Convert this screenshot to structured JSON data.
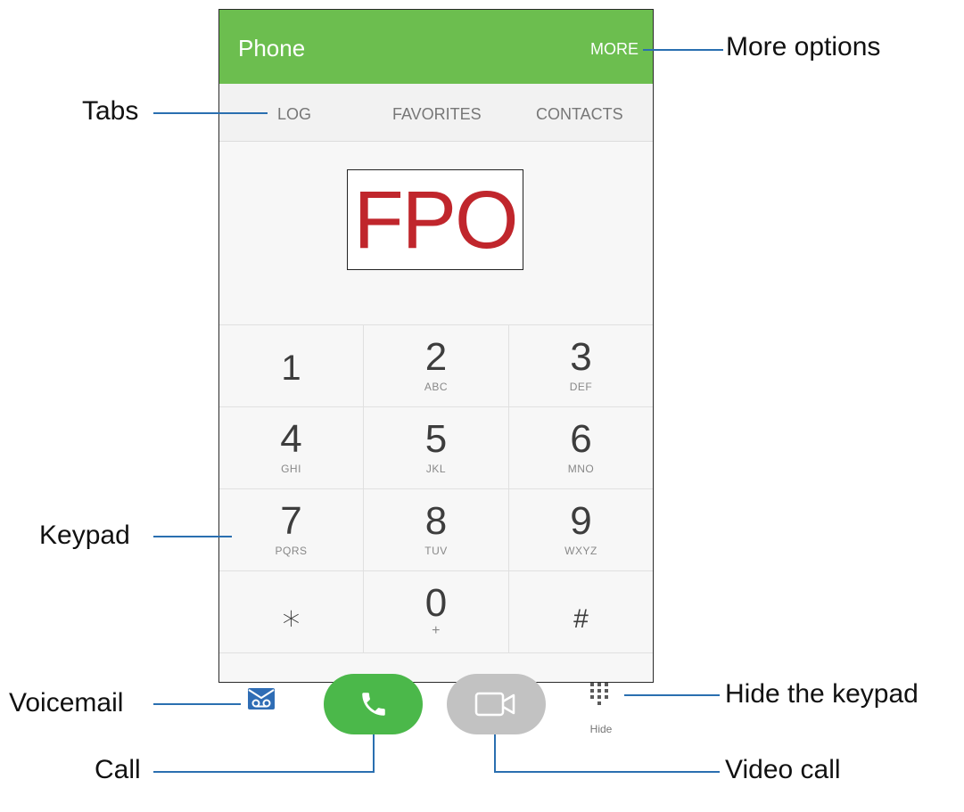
{
  "app": {
    "title": "Phone",
    "more_label": "MORE",
    "accent_color": "#6cbe4f"
  },
  "tabs": [
    {
      "label": "LOG"
    },
    {
      "label": "FAVORITES"
    },
    {
      "label": "CONTACTS"
    }
  ],
  "display": {
    "placeholder_text": "FPO"
  },
  "keypad": {
    "keys": [
      {
        "digit": "1",
        "letters": ""
      },
      {
        "digit": "2",
        "letters": "ABC"
      },
      {
        "digit": "3",
        "letters": "DEF"
      },
      {
        "digit": "4",
        "letters": "GHI"
      },
      {
        "digit": "5",
        "letters": "JKL"
      },
      {
        "digit": "6",
        "letters": "MNO"
      },
      {
        "digit": "7",
        "letters": "PQRS"
      },
      {
        "digit": "8",
        "letters": "TUV"
      },
      {
        "digit": "9",
        "letters": "WXYZ"
      },
      {
        "digit": "⁎",
        "letters": ""
      },
      {
        "digit": "0",
        "letters": "+"
      },
      {
        "digit": "#",
        "letters": ""
      }
    ]
  },
  "actions": {
    "voicemail_icon": "voicemail-icon",
    "call_icon": "phone-icon",
    "video_icon": "video-camera-icon",
    "hide_icon": "keypad-grid-icon",
    "hide_label": "Hide",
    "call_color": "#4bb84a",
    "video_color": "#c2c2c2"
  },
  "callouts": {
    "more_options": "More options",
    "tabs": "Tabs",
    "keypad": "Keypad",
    "voicemail": "Voicemail",
    "hide_keypad": "Hide the keypad",
    "call": "Call",
    "video_call": "Video call"
  }
}
